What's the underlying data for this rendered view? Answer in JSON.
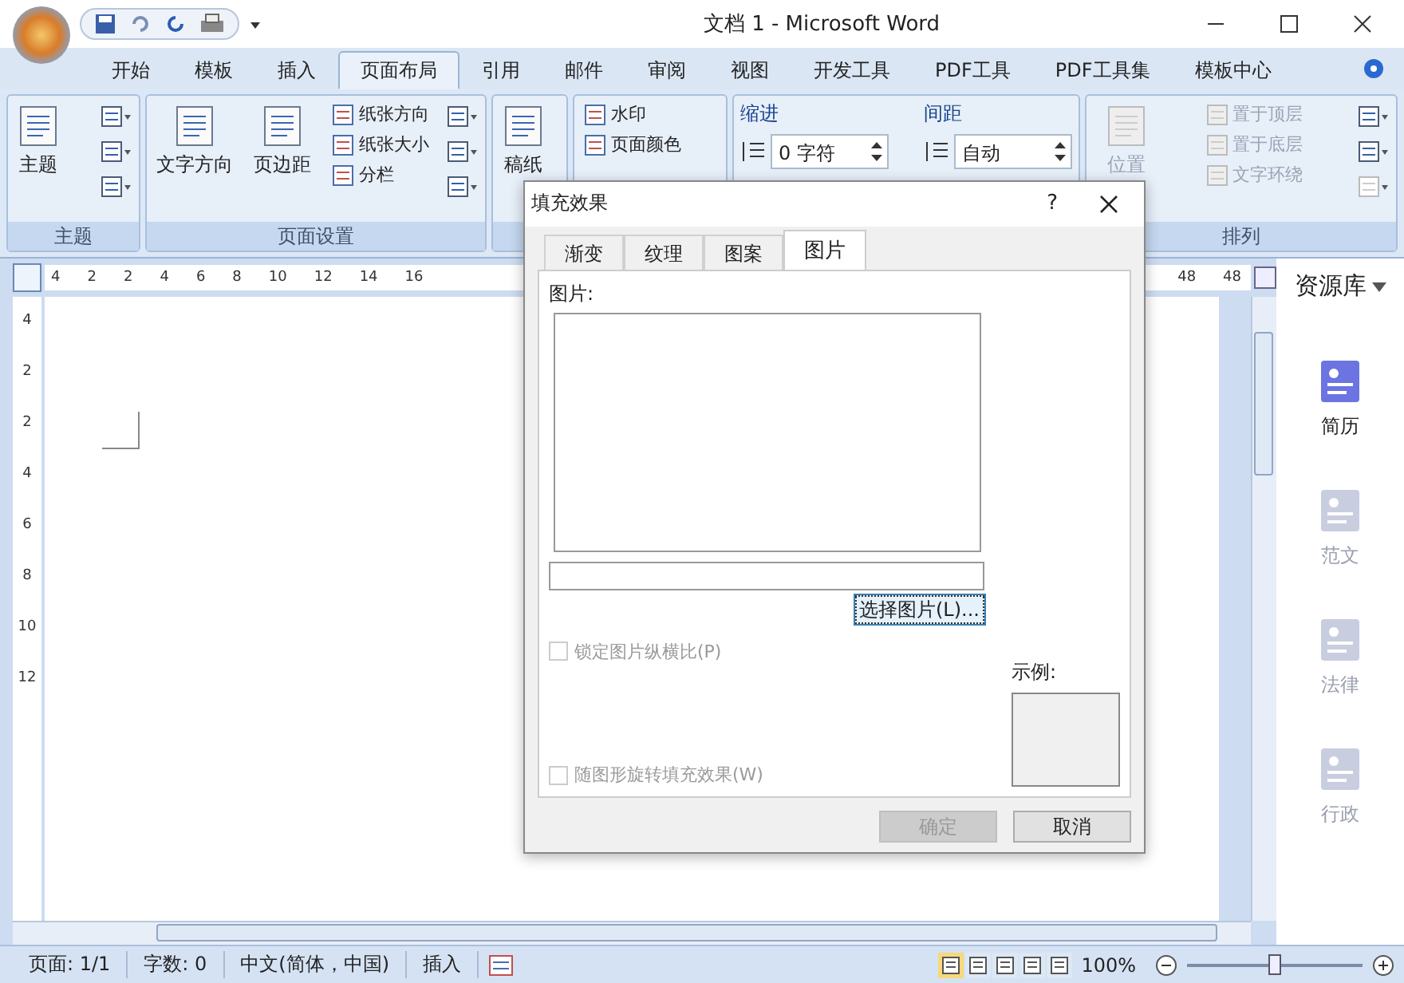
{
  "window": {
    "title": "文档 1 - Microsoft Word"
  },
  "tabs": [
    {
      "label": "开始",
      "selected": false
    },
    {
      "label": "模板",
      "selected": false
    },
    {
      "label": "插入",
      "selected": false
    },
    {
      "label": "页面布局",
      "selected": true
    },
    {
      "label": "引用",
      "selected": false
    },
    {
      "label": "邮件",
      "selected": false
    },
    {
      "label": "审阅",
      "selected": false
    },
    {
      "label": "视图",
      "selected": false
    },
    {
      "label": "开发工具",
      "selected": false
    },
    {
      "label": "PDF工具",
      "selected": false
    },
    {
      "label": "PDF工具集",
      "selected": false
    },
    {
      "label": "模板中心",
      "selected": false
    }
  ],
  "ribbon": {
    "groups": [
      {
        "label": "主题",
        "columns": [
          [
            {
              "kind": "large",
              "label": "主题",
              "disabled": false
            }
          ],
          [
            {
              "kind": "icon",
              "disabled": false
            },
            {
              "kind": "icon",
              "disabled": false
            },
            {
              "kind": "icon",
              "disabled": false
            }
          ]
        ]
      },
      {
        "label": "页面设置",
        "columns": [
          [
            {
              "kind": "large",
              "label": "文字方向",
              "disabled": false
            }
          ],
          [
            {
              "kind": "large",
              "label": "页边距",
              "disabled": false
            }
          ],
          [
            {
              "kind": "small",
              "label": "纸张方向",
              "disabled": false
            },
            {
              "kind": "small",
              "label": "纸张大小",
              "disabled": false
            },
            {
              "kind": "small",
              "label": "分栏",
              "disabled": false
            }
          ],
          [
            {
              "kind": "icon",
              "disabled": false
            },
            {
              "kind": "icon",
              "disabled": false
            },
            {
              "kind": "icon",
              "disabled": false
            }
          ]
        ]
      },
      {
        "columns": [
          [
            {
              "kind": "large",
              "label": "稿纸",
              "disabled": false
            }
          ]
        ]
      },
      {
        "columns": [
          [
            {
              "kind": "small",
              "label": "水印",
              "disabled": false
            },
            {
              "kind": "small",
              "label": "页面颜色",
              "disabled": false
            }
          ]
        ]
      },
      {
        "columns": [
          [
            {
              "kind": "spinner",
              "label": "缩进",
              "value": "0 字符"
            }
          ],
          [
            {
              "kind": "spinner",
              "label": "间距",
              "value": "自动"
            }
          ]
        ]
      },
      {
        "label": "排列",
        "columns": [
          [
            {
              "kind": "large",
              "label": "位置",
              "disabled": true
            }
          ],
          [
            {
              "kind": "small",
              "label": "置于顶层",
              "disabled": true
            },
            {
              "kind": "small",
              "label": "置于底层",
              "disabled": true
            },
            {
              "kind": "small",
              "label": "文字环绕",
              "disabled": true
            }
          ],
          [
            {
              "kind": "icon",
              "disabled": false
            },
            {
              "kind": "icon",
              "disabled": false
            },
            {
              "kind": "icon",
              "disabled": true
            }
          ]
        ]
      }
    ]
  },
  "ruler": {
    "left_labels": [
      "4",
      "2",
      "2",
      "4",
      "6",
      "8",
      "10",
      "12",
      "14",
      "16"
    ],
    "right_labels": [
      "48",
      "48"
    ],
    "vertical_labels": [
      "4",
      "2",
      "2",
      "4",
      "6",
      "8",
      "10",
      "12"
    ]
  },
  "resource_pane": {
    "title": "资源库",
    "items": [
      {
        "label": "简历",
        "selected": true
      },
      {
        "label": "范文",
        "selected": false
      },
      {
        "label": "法律",
        "selected": false
      },
      {
        "label": "行政",
        "selected": false
      }
    ]
  },
  "status_bar": {
    "items": [
      "页面: 1/1",
      "字数: 0",
      "中文(简体，中国)",
      "插入"
    ],
    "views": [
      {
        "selected": true
      },
      {
        "selected": false
      },
      {
        "selected": false
      },
      {
        "selected": false
      },
      {
        "selected": false
      }
    ],
    "zoom": "100%",
    "level": 0.5
  },
  "dialog": {
    "title": "填充效果",
    "help": "?",
    "tabs": [
      {
        "label": "渐变",
        "selected": false
      },
      {
        "label": "纹理",
        "selected": false
      },
      {
        "label": "图案",
        "selected": false
      },
      {
        "label": "图片",
        "selected": true
      }
    ],
    "picture_label": "图片:",
    "choose_button": "选择图片(L)...",
    "checkboxes": [
      {
        "label": "锁定图片纵横比(P)",
        "checked": false,
        "disabled": true
      },
      {
        "label": "随图形旋转填充效果(W)",
        "checked": false,
        "disabled": true
      }
    ],
    "sample_label": "示例:",
    "buttons": [
      {
        "label": "确定",
        "disabled": true
      },
      {
        "label": "取消",
        "disabled": false
      }
    ]
  }
}
